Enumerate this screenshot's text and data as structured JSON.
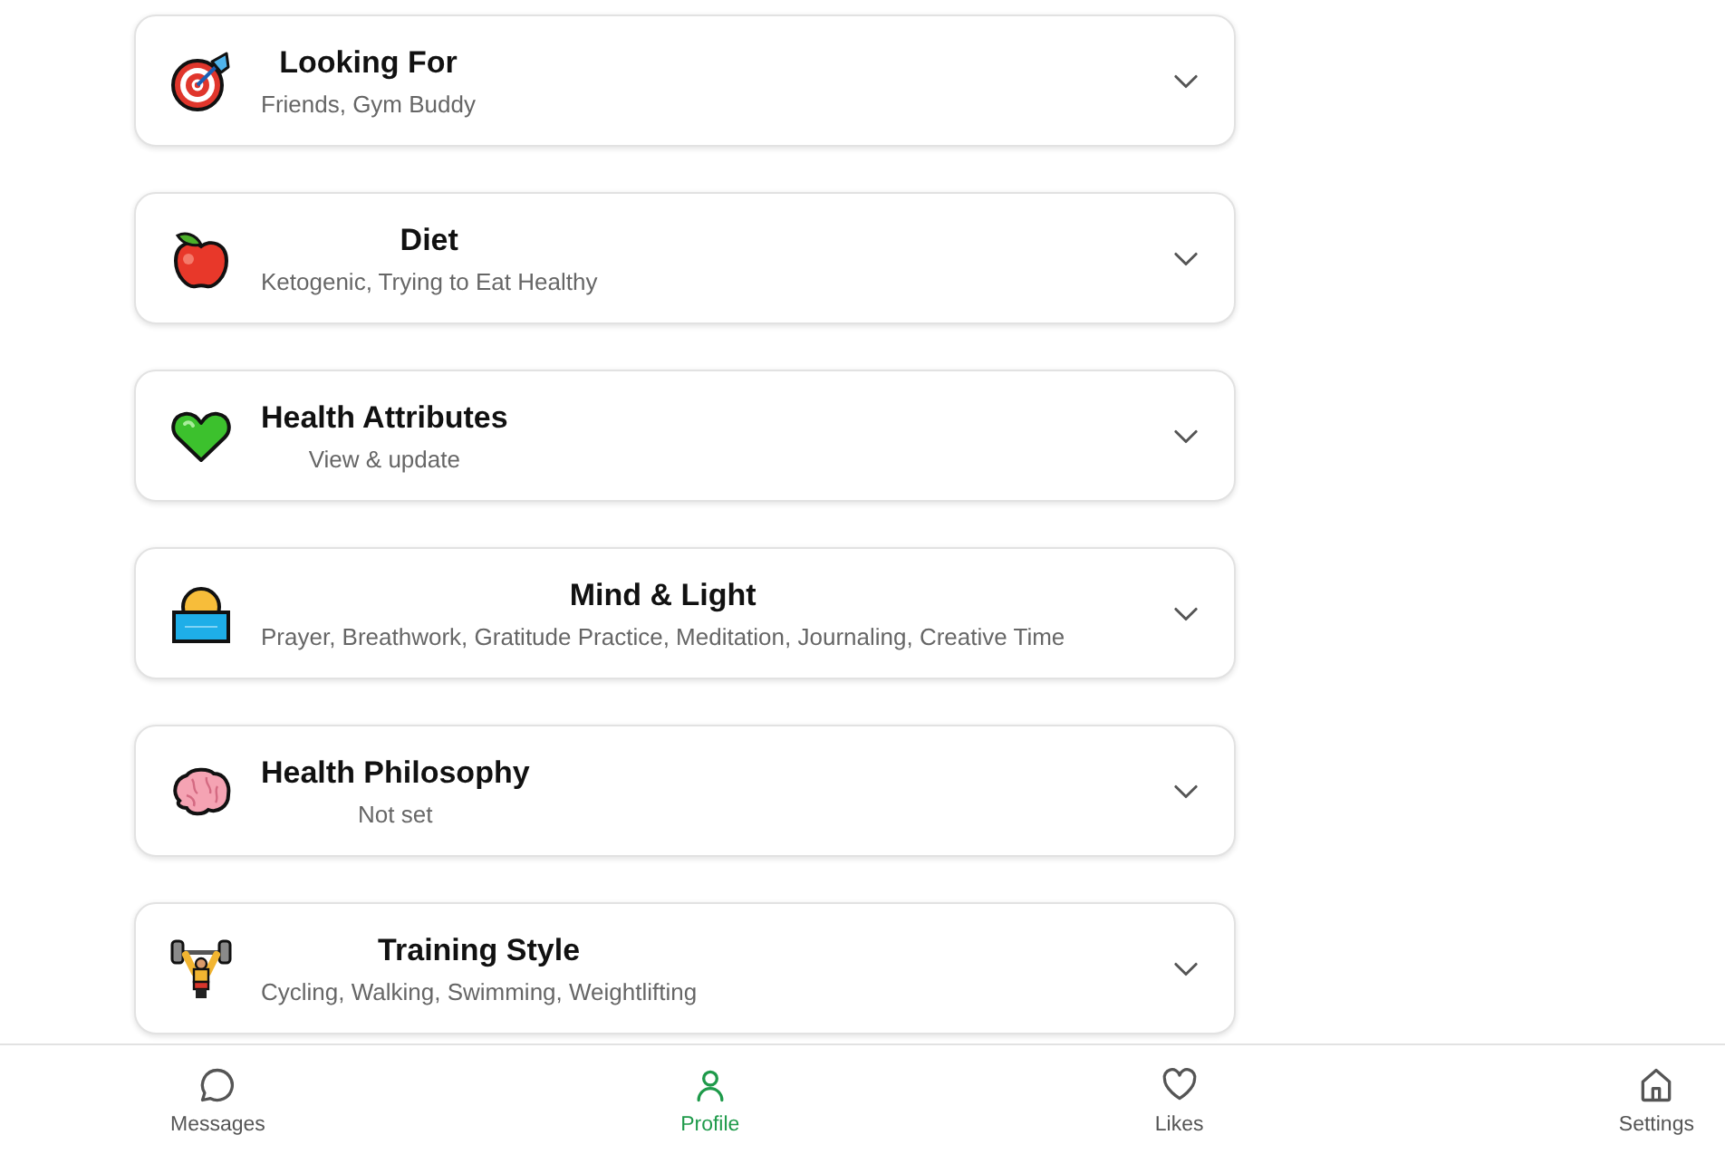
{
  "sections": [
    {
      "title": "Looking For",
      "summary": "Friends, Gym Buddy",
      "expanded": false
    },
    {
      "title": "Diet",
      "summary": "Ketogenic, Trying to Eat Healthy",
      "expanded": false
    },
    {
      "title": "Health Attributes",
      "summary": "View & update",
      "expanded": false
    },
    {
      "title": "Mind & Light",
      "summary": "Prayer, Breathwork, Gratitude Practice, Meditation, Journaling, Creative Time",
      "expanded": false
    },
    {
      "title": "Health Philosophy",
      "summary": "Not set",
      "expanded": false
    },
    {
      "title": "Training Style",
      "summary": "Cycling, Walking, Swimming, Weightlifting",
      "expanded": false
    }
  ],
  "navigation": [
    {
      "label": "Messages",
      "selected": false
    },
    {
      "label": "Profile",
      "selected": true
    },
    {
      "label": "Likes",
      "selected": false
    },
    {
      "label": "Settings",
      "selected": false
    }
  ]
}
